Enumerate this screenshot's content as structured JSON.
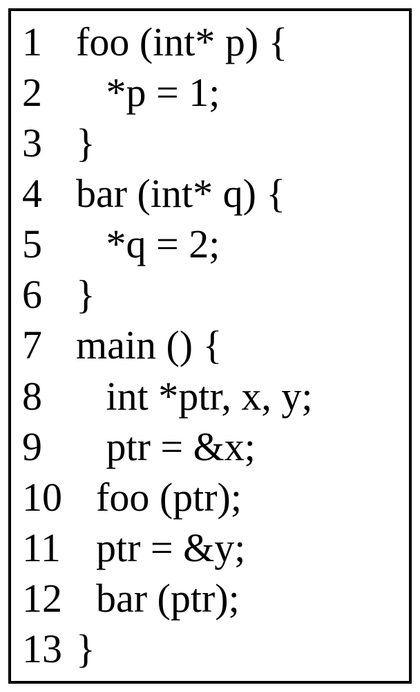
{
  "code": {
    "lines": [
      {
        "number": "1",
        "content": "foo (int* p) {"
      },
      {
        "number": "2",
        "content": "   *p = 1;"
      },
      {
        "number": "3",
        "content": "}"
      },
      {
        "number": "4",
        "content": "bar (int* q) {"
      },
      {
        "number": "5",
        "content": "   *q = 2;"
      },
      {
        "number": "6",
        "content": "}"
      },
      {
        "number": "7",
        "content": "main () {"
      },
      {
        "number": "8",
        "content": "   int *ptr, x, y;"
      },
      {
        "number": "9",
        "content": "   ptr = &x;"
      },
      {
        "number": "10",
        "content": "  foo (ptr);"
      },
      {
        "number": "11",
        "content": "  ptr = &y;"
      },
      {
        "number": "12",
        "content": "  bar (ptr);"
      },
      {
        "number": "13",
        "content": "}"
      }
    ]
  }
}
